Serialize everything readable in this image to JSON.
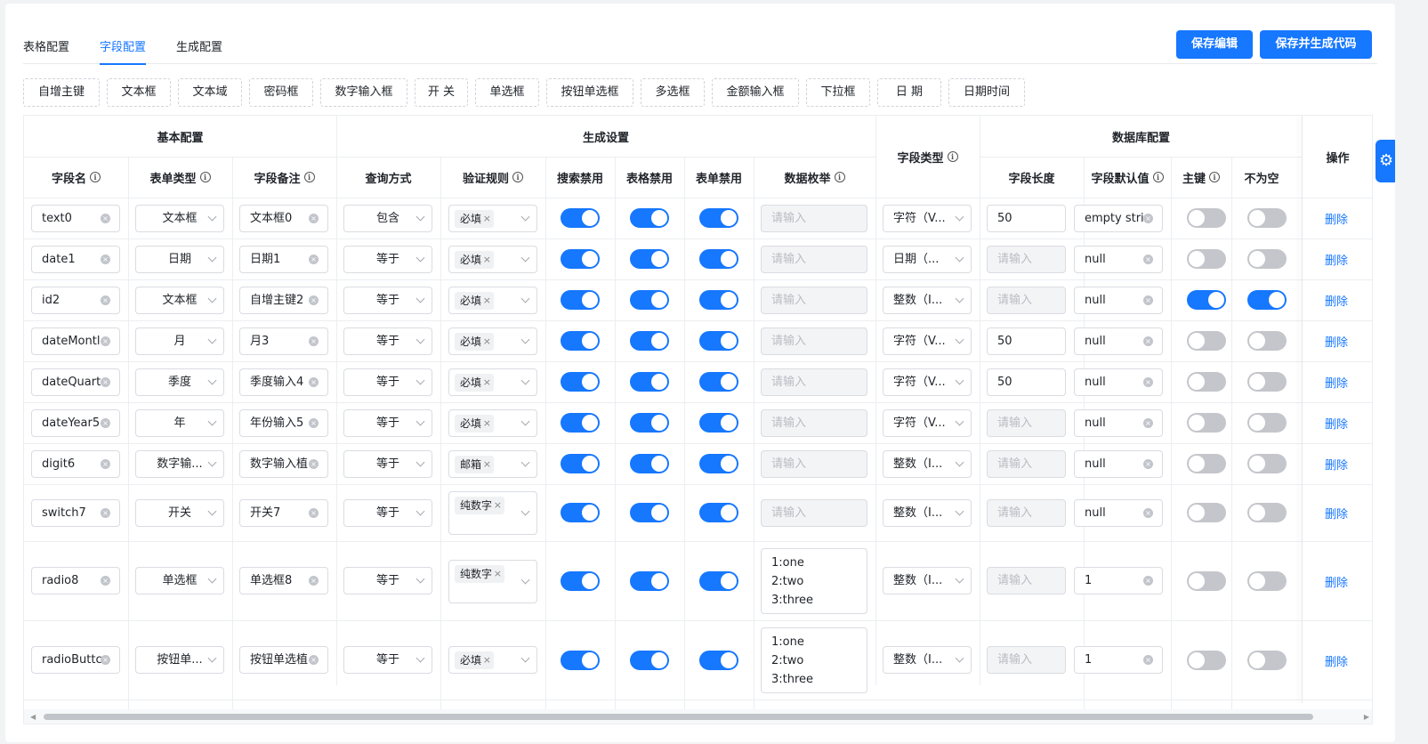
{
  "tabs": [
    "表格配置",
    "字段配置",
    "生成配置"
  ],
  "active_tab": "字段配置",
  "buttons": {
    "save_edit": "保存编辑",
    "save_generate": "保存并生成代码"
  },
  "field_tags": [
    "自增主键",
    "文本框",
    "文本域",
    "密码框",
    "数字输入框",
    "开 关",
    "单选框",
    "按钮单选框",
    "多选框",
    "金额输入框",
    "下拉框",
    "日 期",
    "日期时间"
  ],
  "groups": {
    "basic": "基本配置",
    "generate": "生成设置",
    "field_type": "字段类型",
    "db": "数据库配置",
    "ops": "操作"
  },
  "columns": {
    "field_name": "字段名",
    "form_type": "表单类型",
    "remark": "字段备注",
    "query": "查询方式",
    "rule": "验证规则",
    "search_disable": "搜索禁用",
    "table_disable": "表格禁用",
    "form_disable": "表单禁用",
    "enum": "数据枚举",
    "length": "字段长度",
    "default": "字段默认值",
    "pk": "主键",
    "notnull": "不为空"
  },
  "placeholder": "请输入",
  "delete_label": "删除",
  "rows": [
    {
      "name": "text0",
      "form": "文本框",
      "remark": "文本框0",
      "query": "包含",
      "rule": "必填",
      "search": true,
      "table": true,
      "formd": true,
      "enum": "",
      "type": "字符（V...",
      "length": "50",
      "default": "empty stri",
      "pk": false,
      "notnull": false
    },
    {
      "name": "date1",
      "form": "日期",
      "remark": "日期1",
      "query": "等于",
      "rule": "必填",
      "search": true,
      "table": true,
      "formd": true,
      "enum": "",
      "type": "日期（...",
      "length": "",
      "default": "null",
      "pk": false,
      "notnull": false
    },
    {
      "name": "id2",
      "form": "文本框",
      "remark": "自增主键2",
      "query": "等于",
      "rule": "必填",
      "search": true,
      "table": true,
      "formd": true,
      "enum": "",
      "type": "整数（I...",
      "length": "",
      "default": "null",
      "pk": true,
      "notnull": true
    },
    {
      "name": "dateMontl",
      "form": "月",
      "remark": "月3",
      "query": "等于",
      "rule": "必填",
      "search": true,
      "table": true,
      "formd": true,
      "enum": "",
      "type": "字符（V...",
      "length": "50",
      "default": "null",
      "pk": false,
      "notnull": false
    },
    {
      "name": "dateQuart",
      "form": "季度",
      "remark": "季度输入4",
      "query": "等于",
      "rule": "必填",
      "search": true,
      "table": true,
      "formd": true,
      "enum": "",
      "type": "字符（V...",
      "length": "50",
      "default": "null",
      "pk": false,
      "notnull": false
    },
    {
      "name": "dateYear5",
      "form": "年",
      "remark": "年份输入5",
      "query": "等于",
      "rule": "必填",
      "search": true,
      "table": true,
      "formd": true,
      "enum": "",
      "type": "字符（V...",
      "length": "",
      "default": "null",
      "pk": false,
      "notnull": false
    },
    {
      "name": "digit6",
      "form": "数字输...",
      "remark": "数字输入植",
      "query": "等于",
      "rule": "邮箱",
      "search": true,
      "table": true,
      "formd": true,
      "enum": "",
      "type": "整数（I...",
      "length": "",
      "default": "null",
      "pk": false,
      "notnull": false
    },
    {
      "name": "switch7",
      "form": "开关",
      "remark": "开关7",
      "query": "等于",
      "rule": "纯数字",
      "search": true,
      "table": true,
      "formd": true,
      "enum": "",
      "type": "整数（I...",
      "length": "",
      "default": "null",
      "pk": false,
      "notnull": false
    },
    {
      "name": "radio8",
      "form": "单选框",
      "remark": "单选框8",
      "query": "等于",
      "rule": "纯数字",
      "search": true,
      "table": true,
      "formd": true,
      "enum": "1:one\n2:two\n3:three",
      "type": "整数（I...",
      "length": "",
      "default": "1",
      "pk": false,
      "notnull": false
    },
    {
      "name": "radioButtc",
      "form": "按钮单...",
      "remark": "按钮单选植",
      "query": "等于",
      "rule": "必填",
      "search": true,
      "table": true,
      "formd": true,
      "enum": "1:one\n2:two\n3:three",
      "type": "整数（I...",
      "length": "",
      "default": "1",
      "pk": false,
      "notnull": false
    }
  ]
}
